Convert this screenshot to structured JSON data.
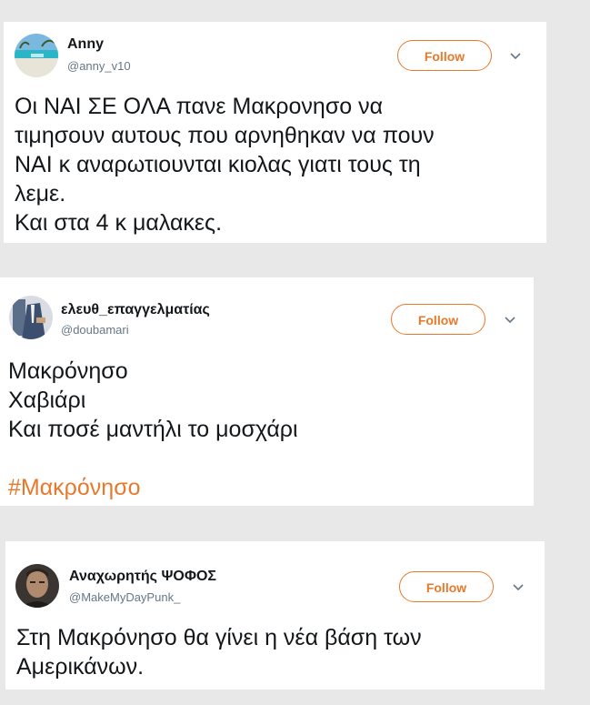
{
  "tweets": [
    {
      "display_name": "Anny",
      "handle": "@anny_v10",
      "follow_label": "Follow",
      "avatar_icon": "beach-photo",
      "text_lines": [
        "Οι ΝΑΙ ΣΕ ΟΛΑ πανε Μακρονησο να",
        "τιμησουν αυτους που αρνηθηκαν να πουν",
        "ΝΑΙ κ αναρωτιουνται κιολας γιατι τους τη",
        "λεμε.",
        "Και στα 4 κ μαλακες."
      ]
    },
    {
      "display_name": "ελευθ_επαγγελματίας",
      "handle": "@doubamari",
      "follow_label": "Follow",
      "avatar_icon": "suited-man-photo",
      "text_lines": [
        "Μακρόνησο",
        "Χαβιάρι",
        "Και ποσέ μαντήλι το μοσχάρι"
      ],
      "hashtag": "#Μακρόνησο"
    },
    {
      "display_name": "Αναχωρητής ΨΟΦΟΣ",
      "handle": "@MakeMyDayPunk_",
      "follow_label": "Follow",
      "avatar_icon": "man-portrait-photo",
      "text_lines": [
        "Στη Μακρόνησο θα γίνει η νέα βάση των",
        "Αμερικάνων."
      ]
    }
  ],
  "colors": {
    "accent": "#e8792b",
    "text": "#14171a",
    "muted": "#657786",
    "background": "#e8e8e8",
    "card": "#ffffff"
  }
}
